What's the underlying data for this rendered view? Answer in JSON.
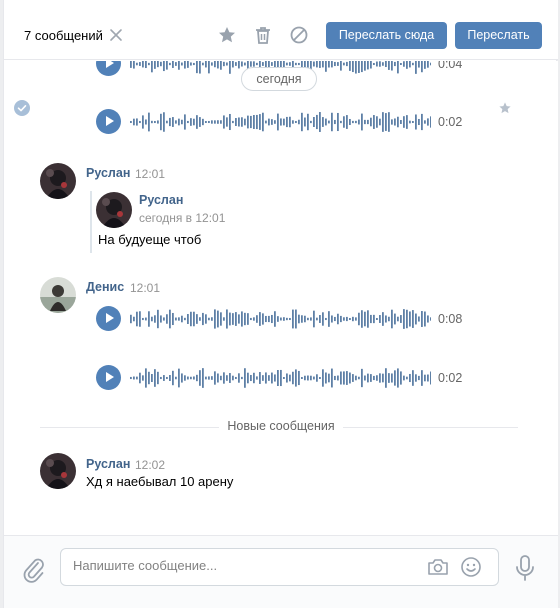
{
  "header": {
    "selected_count": "7 сообщений",
    "forward_here_label": "Переслать сюда",
    "forward_label": "Переслать"
  },
  "date_separator": "сегодня",
  "voice_top": {
    "duration_partial": "0:04",
    "duration": "0:02"
  },
  "ruslan_message": {
    "author": "Руслан",
    "time": "12:01",
    "forwarded": {
      "author": "Руслан",
      "time": "сегодня в 12:01",
      "text": "На будуеще чтоб"
    }
  },
  "denis_message": {
    "author": "Денис",
    "time": "12:01",
    "voice1_duration": "0:08",
    "voice2_duration": "0:02"
  },
  "new_messages_divider": "Новые сообщения",
  "last_message": {
    "author": "Руслан",
    "time": "12:02",
    "text": "Хд я наебывал 10 арену"
  },
  "composer": {
    "placeholder": "Напишите сообщение..."
  },
  "colors": {
    "accent": "#5181b8",
    "author": "#42648b",
    "muted": "#939393"
  },
  "icons": [
    "close-icon",
    "star-icon",
    "trash-icon",
    "block-icon",
    "check-circle-icon",
    "play-icon",
    "attach-icon",
    "camera-icon",
    "smile-icon",
    "mic-icon"
  ]
}
